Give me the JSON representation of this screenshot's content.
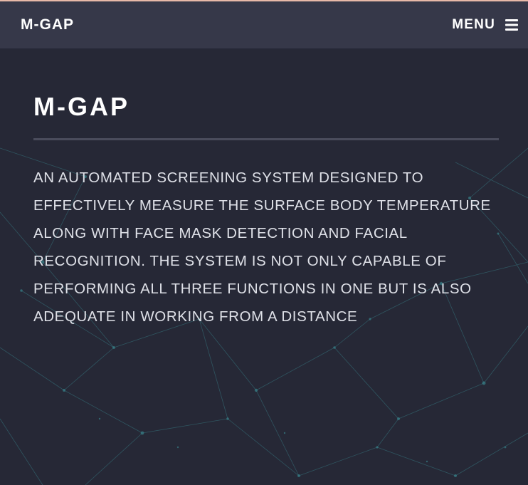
{
  "navbar": {
    "brand": "M-GAP",
    "menu_label": "MENU",
    "menu_icon": "hamburger-icon"
  },
  "hero": {
    "title": "M-GAP",
    "description": "AN AUTOMATED SCREENING SYSTEM DESIGNED TO EFFECTIVELY MEASURE THE SURFACE BODY TEMPERATURE ALONG WITH FACE MASK DETECTION AND FACIAL RECOGNITION. THE SYSTEM IS NOT ONLY CAPABLE OF PERFORMING ALL THREE FUNCTIONS IN ONE BUT IS ALSO ADEQUATE IN WORKING FROM A DISTANCE"
  },
  "colors": {
    "page_background": "#262836",
    "navbar_background": "#363849",
    "top_accent": "#e8b9a8",
    "network_accent": "#3a8c94",
    "text": "#ffffff"
  }
}
